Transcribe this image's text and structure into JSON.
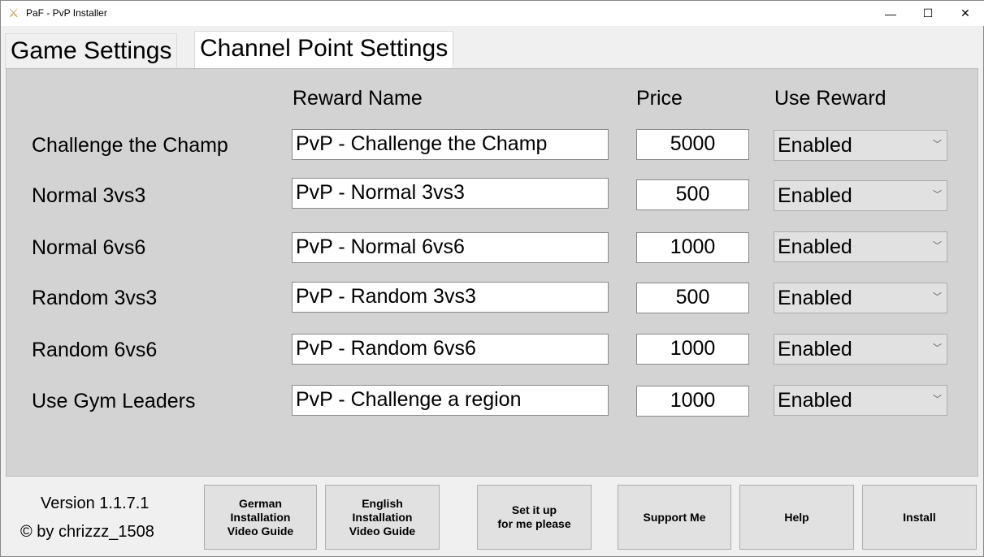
{
  "window": {
    "title": "PaF - PvP Installer",
    "icon": "crossed-swords-icon",
    "minimize": "—",
    "maximize": "☐",
    "close": "✕"
  },
  "tabs": [
    {
      "label": "Game Settings",
      "active": false
    },
    {
      "label": "Channel Point Settings",
      "active": true
    }
  ],
  "headers": {
    "reward_name": "Reward Name",
    "price": "Price",
    "use_reward": "Use Reward"
  },
  "rows": [
    {
      "label": "Challenge the Champ",
      "reward_name": "PvP - Challenge the Champ",
      "price": "5000",
      "use_reward": "Enabled"
    },
    {
      "label": "Normal 3vs3",
      "reward_name": "PvP - Normal 3vs3",
      "price": "500",
      "use_reward": "Enabled"
    },
    {
      "label": "Normal 6vs6",
      "reward_name": "PvP - Normal 6vs6",
      "price": "1000",
      "use_reward": "Enabled"
    },
    {
      "label": "Random 3vs3",
      "reward_name": "PvP - Random 3vs3",
      "price": "500",
      "use_reward": "Enabled"
    },
    {
      "label": "Random 6vs6",
      "reward_name": "PvP - Random 6vs6",
      "price": "1000",
      "use_reward": "Enabled"
    },
    {
      "label": "Use Gym Leaders",
      "reward_name": "PvP - Challenge a region",
      "price": "1000",
      "use_reward": "Enabled"
    }
  ],
  "footer": {
    "version": "Version 1.1.7.1",
    "author": "© by chrizzz_1508"
  },
  "buttons": {
    "german_guide": "German\nInstallation\nVideo Guide",
    "english_guide": "English\nInstallation\nVideo Guide",
    "setup": "Set it up\nfor me please",
    "support": "Support Me",
    "help": "Help",
    "install": "Install"
  }
}
